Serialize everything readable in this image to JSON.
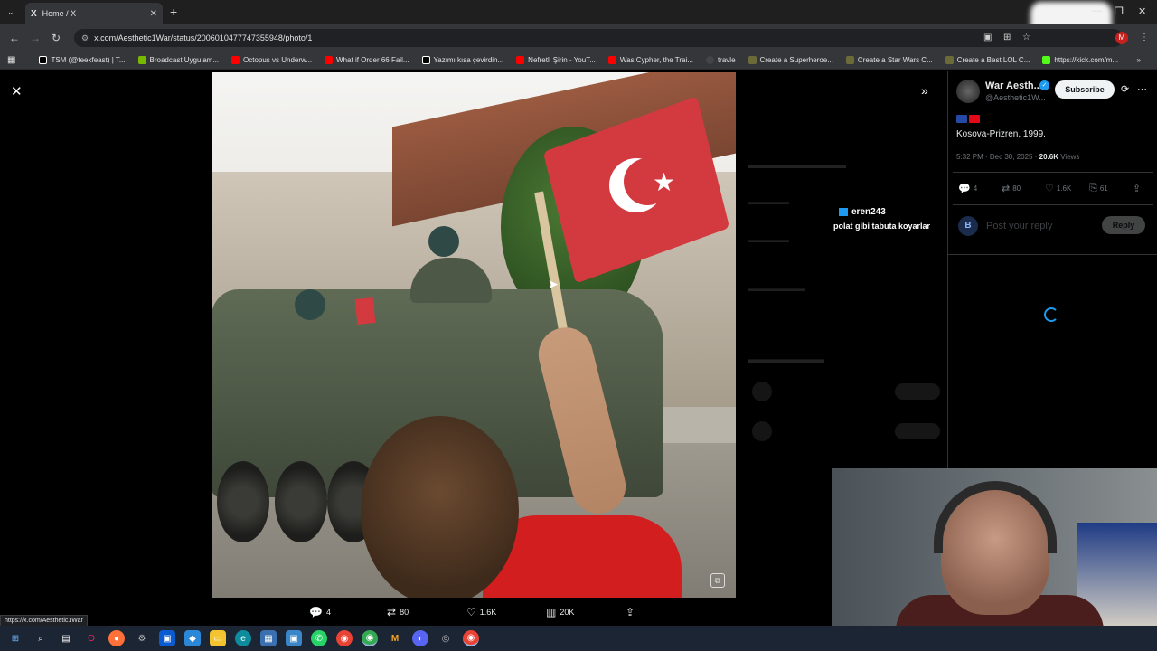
{
  "browser": {
    "tab_title": "Home / X",
    "tab_logo": "X",
    "url": "x.com/Aesthetic1War/status/2006010477747355948/photo/1",
    "status_url": "https://x.com/Aesthetic1War",
    "profile_initial": "M",
    "bookmarks": [
      {
        "label": "TSM (@teekfeast) | T...",
        "color": "#000000"
      },
      {
        "label": "Broadcast Uygulam...",
        "color": "#76b900"
      },
      {
        "label": "Octopus vs Underw...",
        "color": "#ff0000"
      },
      {
        "label": "What if Order 66 Fail...",
        "color": "#ff0000"
      },
      {
        "label": "Yazımı kısa çevirdin...",
        "color": "#000000"
      },
      {
        "label": "Nefretli Şirin - YouT...",
        "color": "#ff0000"
      },
      {
        "label": "Was Cypher, the Trai...",
        "color": "#ff0000"
      },
      {
        "label": "travle",
        "color": "#444444"
      },
      {
        "label": "Create a Superheroe...",
        "color": "#6b6b3a"
      },
      {
        "label": "Create a Star Wars C...",
        "color": "#6b6b3a"
      },
      {
        "label": "Create a Best LOL C...",
        "color": "#6b6b3a"
      },
      {
        "label": "https://kick.com/m...",
        "color": "#53fc18"
      }
    ]
  },
  "photo_actions": {
    "replies": "4",
    "reposts": "80",
    "likes": "1.6K",
    "views": "20K"
  },
  "tweet": {
    "display_name": "War Aesth...",
    "handle": "@Aesthetic1W...",
    "subscribe_label": "Subscribe",
    "text": "Kosova-Prizren, 1999.",
    "time": "5:32 PM · Dec 30, 2025 ·",
    "views_count": "20.6K",
    "views_label": "Views",
    "replies": "4",
    "reposts": "80",
    "likes": "1.6K",
    "bookmarks": "61",
    "reply_avatar_initial": "B",
    "reply_placeholder": "Post your reply",
    "reply_button": "Reply"
  },
  "chat": {
    "username": "eren243",
    "message": "polat gibi tabuta koyarlar"
  },
  "icons": {
    "close": "close-icon",
    "expand": "chevron-double-right-icon",
    "reply": "reply-icon",
    "repost": "repost-icon",
    "like": "heart-icon",
    "views": "bar-chart-icon",
    "share": "share-icon",
    "bookmark": "bookmark-icon"
  },
  "colors": {
    "accent": "#1d9bf0",
    "background": "#000000"
  }
}
